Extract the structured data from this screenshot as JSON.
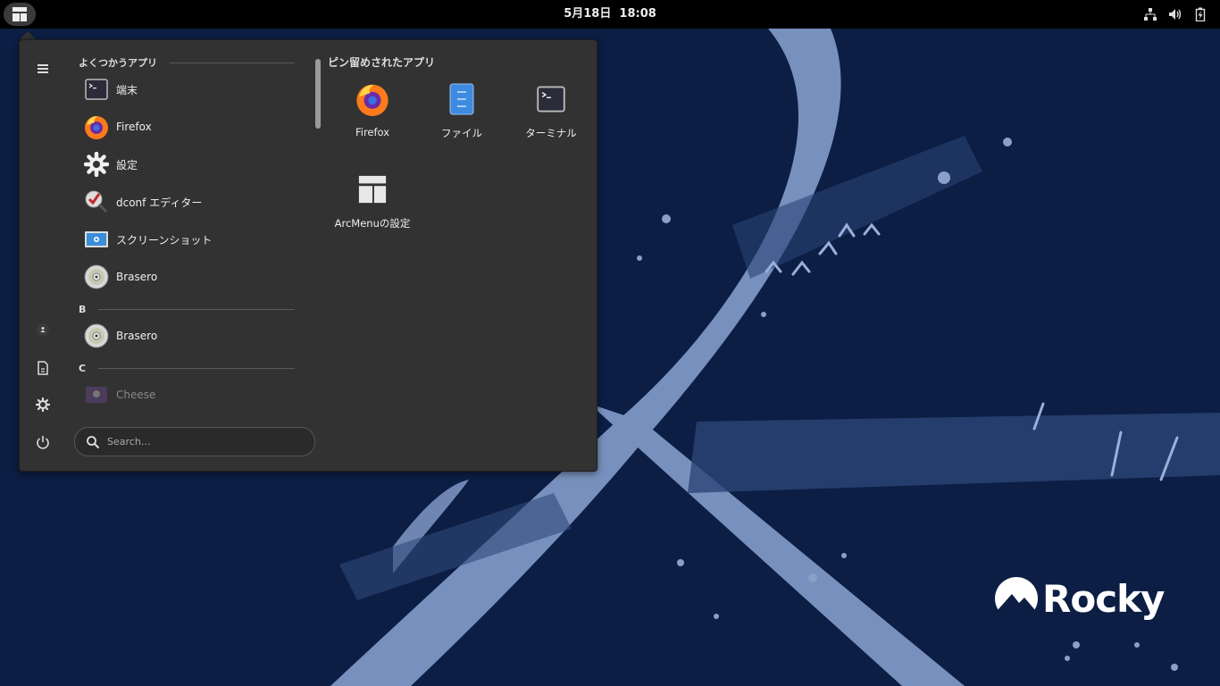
{
  "topbar": {
    "date": "5月18日",
    "time": "18:08"
  },
  "arcmenu": {
    "frequent_title": "よくつかうアプリ",
    "frequent_apps": [
      {
        "label": "端末",
        "icon": "terminal-icon"
      },
      {
        "label": "Firefox",
        "icon": "firefox-icon"
      },
      {
        "label": "設定",
        "icon": "settings-gear-icon"
      },
      {
        "label": "dconf エディター",
        "icon": "dconf-editor-icon"
      },
      {
        "label": "スクリーンショット",
        "icon": "screenshot-icon"
      },
      {
        "label": "Brasero",
        "icon": "disc-icon"
      }
    ],
    "section_b": "B",
    "section_b_apps": [
      {
        "label": "Brasero",
        "icon": "disc-icon"
      }
    ],
    "section_c": "C",
    "section_c_apps": [
      {
        "label": "Cheese",
        "icon": "cheese-webcam-icon"
      }
    ],
    "search": {
      "placeholder": "Search…",
      "value": ""
    },
    "pinned_title": "ピン留めされたアプリ",
    "pinned_apps": [
      {
        "label": "Firefox",
        "icon": "firefox-icon"
      },
      {
        "label": "ファイル",
        "icon": "files-icon"
      },
      {
        "label": "ターミナル",
        "icon": "terminal-icon"
      },
      {
        "label": "ArcMenuの設定",
        "icon": "arcmenu-settings-icon"
      }
    ],
    "sidebar_icons": [
      "hamburger-icon",
      "user-icon",
      "document-icon",
      "gear-icon",
      "power-icon"
    ]
  },
  "wallpaper": {
    "logo_text": "Rocky",
    "colors": {
      "background": "#0d1f45",
      "stroke": "#7a93c0"
    }
  }
}
